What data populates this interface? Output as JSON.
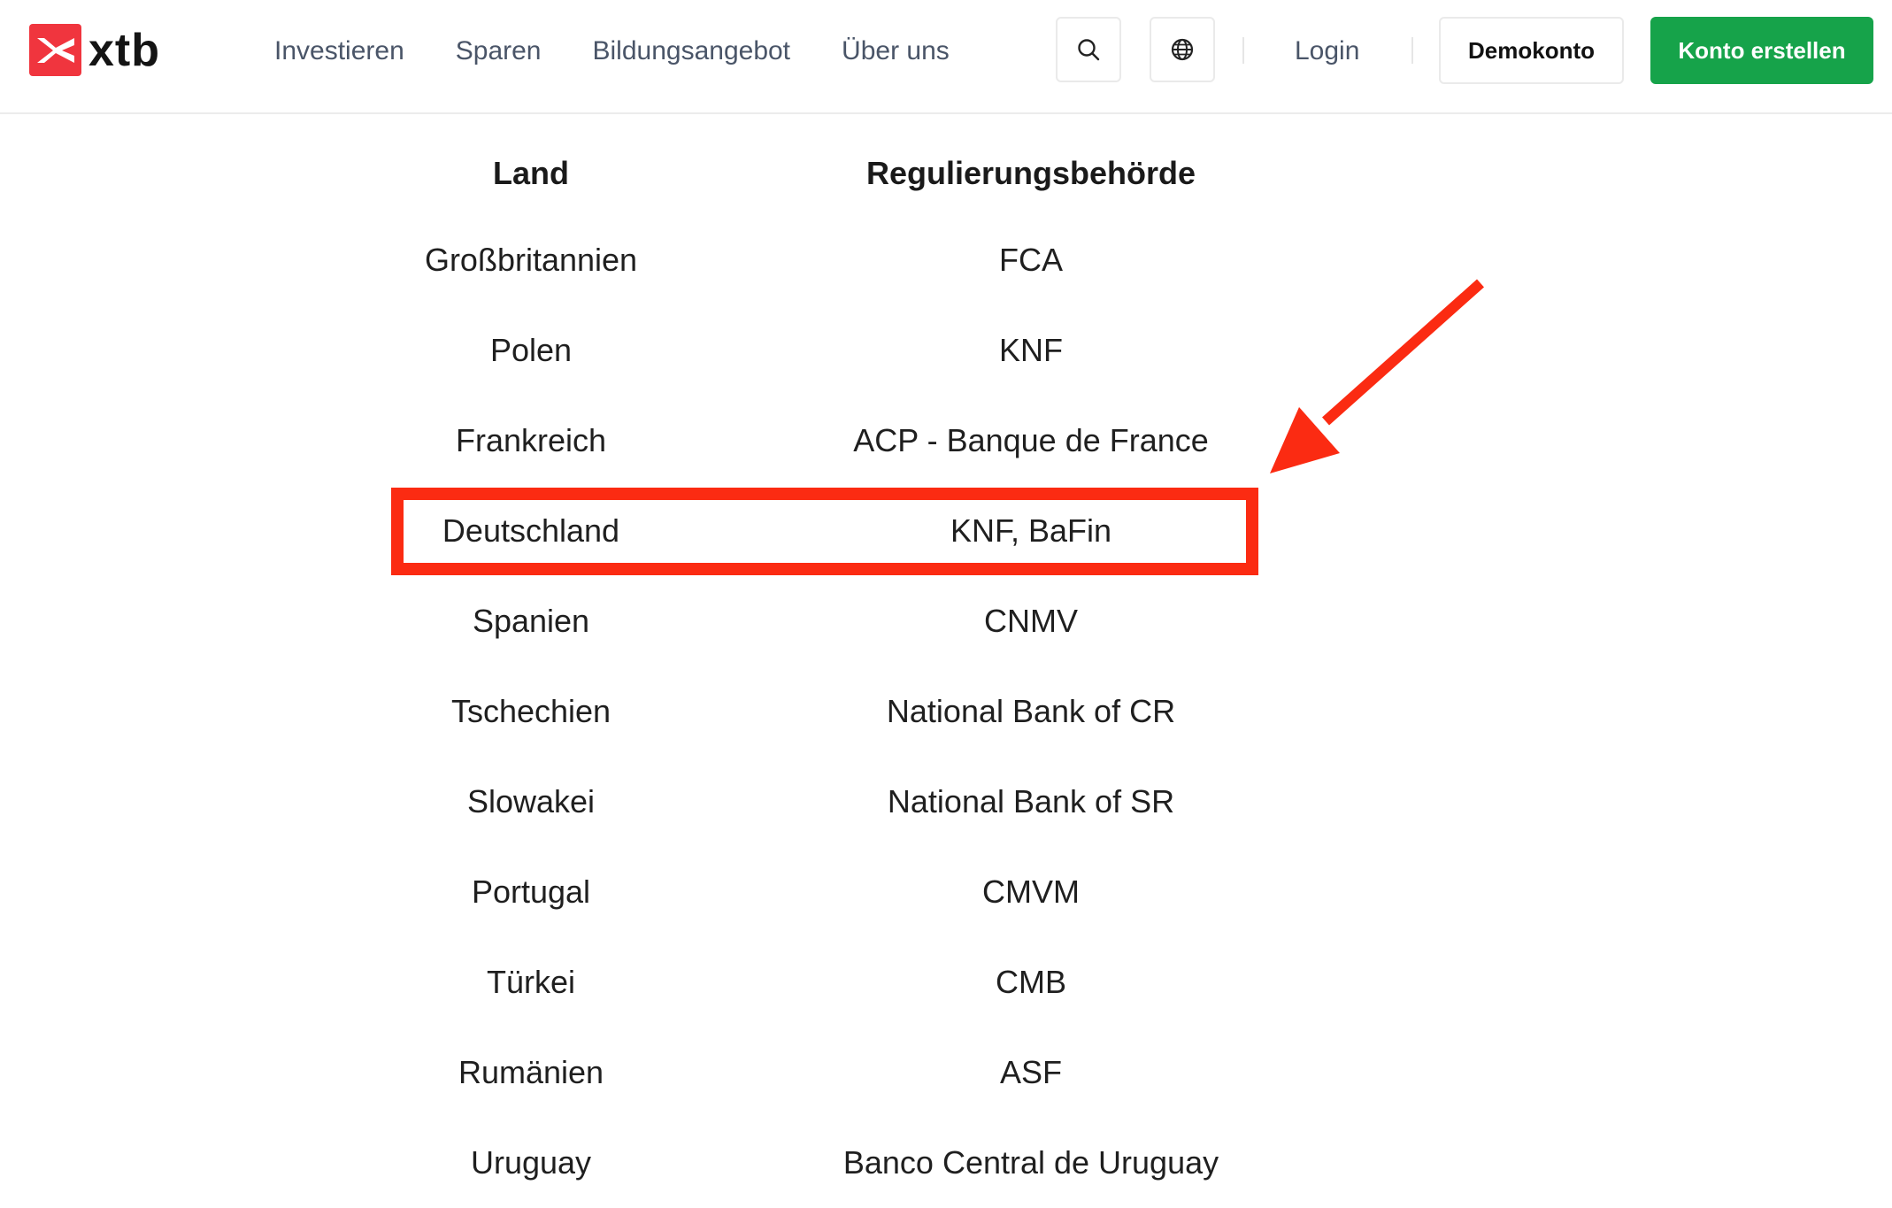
{
  "colors": {
    "brand": "#f0353e",
    "accent": "#16a34a",
    "highlight": "#fb2b12"
  },
  "header": {
    "logo_text": "xtb",
    "nav": [
      "Investieren",
      "Sparen",
      "Bildungsangebot",
      "Über uns"
    ],
    "login": "Login",
    "demo": "Demokonto",
    "cta": "Konto erstellen"
  },
  "table": {
    "headers": {
      "country": "Land",
      "regulator": "Regulierungsbehörde"
    },
    "rows": [
      {
        "country": "Großbritannien",
        "regulator": "FCA"
      },
      {
        "country": "Polen",
        "regulator": "KNF"
      },
      {
        "country": "Frankreich",
        "regulator": "ACP - Banque de France"
      },
      {
        "country": "Deutschland",
        "regulator": "KNF, BaFin"
      },
      {
        "country": "Spanien",
        "regulator": "CNMV"
      },
      {
        "country": "Tschechien",
        "regulator": "National Bank of CR"
      },
      {
        "country": "Slowakei",
        "regulator": "National Bank of SR"
      },
      {
        "country": "Portugal",
        "regulator": "CMVM"
      },
      {
        "country": "Türkei",
        "regulator": "CMB"
      },
      {
        "country": "Rumänien",
        "regulator": "ASF"
      },
      {
        "country": "Uruguay",
        "regulator": "Banco Central de Uruguay"
      }
    ]
  }
}
